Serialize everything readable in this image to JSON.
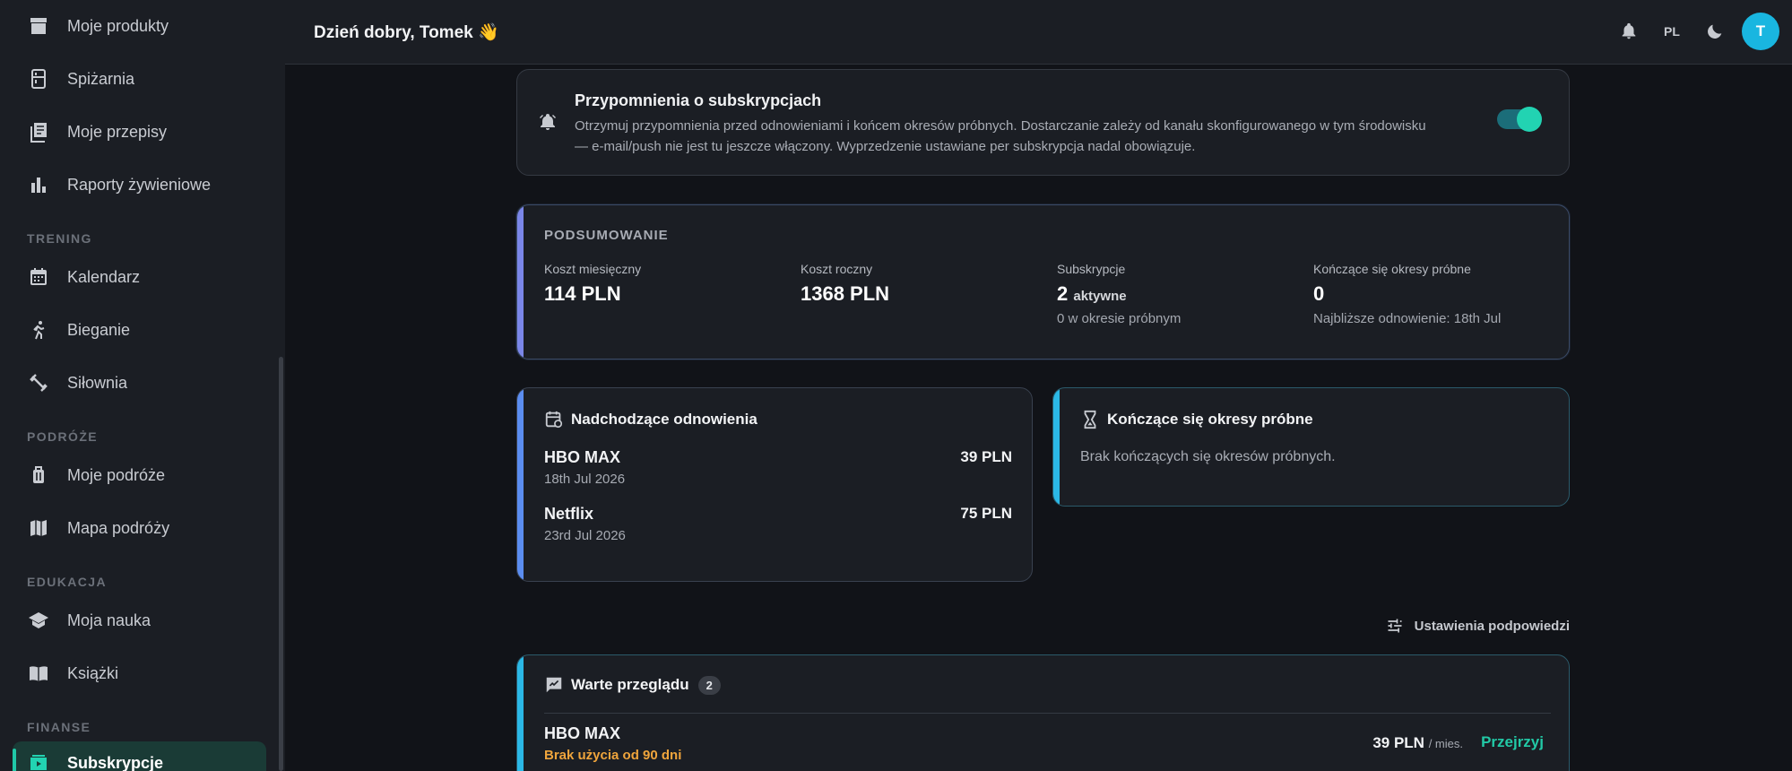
{
  "sidebar": {
    "items": [
      {
        "label": "Moje produkty",
        "icon": "archive-icon"
      },
      {
        "label": "Spiżarnia",
        "icon": "pantry-icon"
      },
      {
        "label": "Moje przepisy",
        "icon": "recipes-icon"
      },
      {
        "label": "Raporty żywieniowe",
        "icon": "bar-chart-icon"
      }
    ],
    "sections": {
      "training": "TRENING",
      "travel": "PODRÓŻE",
      "education": "EDUKACJA",
      "finance": "FINANSE"
    },
    "training_items": [
      {
        "label": "Kalendarz",
        "icon": "calendar-icon"
      },
      {
        "label": "Bieganie",
        "icon": "running-icon"
      },
      {
        "label": "Siłownia",
        "icon": "dumbbell-icon"
      }
    ],
    "travel_items": [
      {
        "label": "Moje podróże",
        "icon": "luggage-icon"
      },
      {
        "label": "Mapa podróży",
        "icon": "map-icon"
      }
    ],
    "education_items": [
      {
        "label": "Moja nauka",
        "icon": "graduation-cap-icon"
      },
      {
        "label": "Książki",
        "icon": "book-icon"
      }
    ],
    "finance_items": [
      {
        "label": "Subskrypcje",
        "icon": "subscriptions-icon",
        "active": true
      }
    ]
  },
  "header": {
    "greeting": "Dzień dobry, Tomek 👋",
    "language": "PL",
    "avatar_initial": "T"
  },
  "reminder": {
    "title": "Przypomnienia o subskrypcjach",
    "description": "Otrzymuj przypomnienia przed odnowieniami i końcem okresów próbnych. Dostarczanie zależy od kanału skonfigurowanego w tym środowisku — e-mail/push nie jest tu jeszcze włączony. Wyprzedzenie ustawiane per subskrypcja nadal obowiązuje.",
    "enabled": true
  },
  "summary": {
    "title": "PODSUMOWANIE",
    "monthly_label": "Koszt miesięczny",
    "monthly_value": "114 PLN",
    "yearly_label": "Koszt roczny",
    "yearly_value": "1368 PLN",
    "subs_label": "Subskrypcje",
    "subs_count": "2",
    "subs_active": "aktywne",
    "subs_trial": "0 w okresie próbnym",
    "ending_label": "Kończące się okresy próbne",
    "ending_value": "0",
    "next_renewal": "Najbliższe odnowienie: 18th Jul"
  },
  "upcoming": {
    "title": "Nadchodzące odnowienia",
    "rows": [
      {
        "name": "HBO MAX",
        "date": "18th Jul 2026",
        "price": "39 PLN"
      },
      {
        "name": "Netflix",
        "date": "23rd Jul 2026",
        "price": "75 PLN"
      }
    ]
  },
  "trials": {
    "title": "Kończące się okresy próbne",
    "empty": "Brak kończących się okresów próbnych."
  },
  "hints": {
    "settings_label": "Ustawienia podpowiedzi"
  },
  "review": {
    "title": "Warte przeglądu",
    "count": "2",
    "item_name": "HBO MAX",
    "item_warning": "Brak użycia od 90 dni",
    "item_price": "39 PLN",
    "item_period": "/ mies.",
    "action": "Przejrzyj"
  }
}
